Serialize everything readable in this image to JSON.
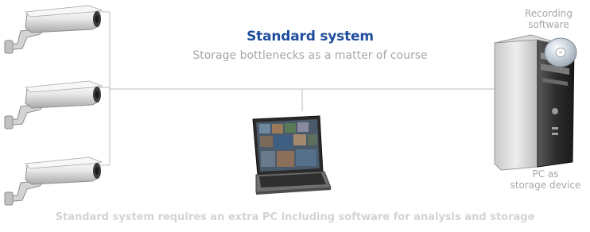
{
  "title": "Standard system",
  "subtitle": "Storage bottlenecks as a matter of course",
  "recording_label": {
    "line1": "Recording",
    "line2": "software"
  },
  "pc_label": {
    "line1": "PC as",
    "line2": "storage device"
  },
  "caption": "Standard system requires an extra PC including software for analysis and storage",
  "colors": {
    "title": "#1f4e9e",
    "muted_text": "#a7a7a7",
    "caption_text": "#d3d3d3",
    "connector_line": "#bdbdbd"
  },
  "icons": [
    "camera-icon",
    "laptop-icon",
    "pc-tower-icon",
    "cd-icon"
  ]
}
